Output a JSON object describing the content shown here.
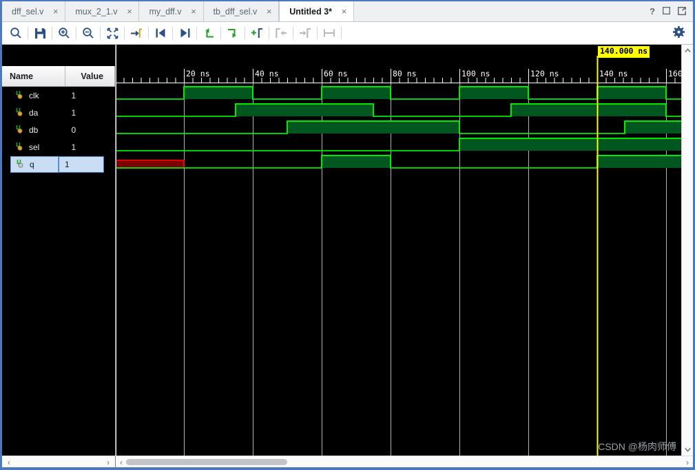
{
  "window": {
    "tabs": [
      {
        "label": "dff_sel.v",
        "active": false,
        "close": "×"
      },
      {
        "label": "mux_2_1.v",
        "active": false,
        "close": "×"
      },
      {
        "label": "my_dff.v",
        "active": false,
        "close": "×"
      },
      {
        "label": "tb_dff_sel.v",
        "active": false,
        "close": "×"
      },
      {
        "label": "Untitled 3*",
        "active": true,
        "close": "×"
      }
    ],
    "buttons": [
      {
        "name": "help-icon",
        "glyph": "?"
      },
      {
        "name": "maximize-icon",
        "glyph": "❑"
      },
      {
        "name": "float-window-icon",
        "glyph": "➦"
      }
    ]
  },
  "toolbar": {
    "items": [
      {
        "name": "search-icon",
        "label": "Search",
        "enabled": true
      },
      {
        "sep": true
      },
      {
        "name": "save-icon",
        "label": "Save Waveform Configuration",
        "enabled": true
      },
      {
        "sep": true
      },
      {
        "name": "zoom-in-icon",
        "label": "Zoom In",
        "enabled": true
      },
      {
        "sep": true
      },
      {
        "name": "zoom-out-icon",
        "label": "Zoom Out",
        "enabled": true
      },
      {
        "sep": true
      },
      {
        "name": "zoom-fit-icon",
        "label": "Zoom Fit",
        "enabled": true
      },
      {
        "sep": true
      },
      {
        "name": "goto-cursor-icon",
        "label": "Go To Time 0",
        "enabled": true
      },
      {
        "sep": true
      },
      {
        "name": "previous-transition-icon",
        "label": "Previous Transition",
        "enabled": true
      },
      {
        "sep": true
      },
      {
        "name": "next-transition-icon",
        "label": "Next Transition",
        "enabled": true
      },
      {
        "sep": true
      },
      {
        "name": "previous-marker-icon",
        "label": "Previous Marker",
        "enabled": true
      },
      {
        "sep": true
      },
      {
        "name": "next-marker-icon",
        "label": "Next Marker",
        "enabled": true
      },
      {
        "sep": true
      },
      {
        "name": "add-marker-icon",
        "label": "Add Marker",
        "enabled": true
      },
      {
        "sep": true
      },
      {
        "name": "marker-left-icon",
        "label": "Move Marker Left",
        "enabled": false
      },
      {
        "sep": true
      },
      {
        "name": "marker-right-icon",
        "label": "Move Marker Right",
        "enabled": false
      },
      {
        "sep": true
      },
      {
        "name": "measure-icon",
        "label": "Measure Time",
        "enabled": false
      },
      {
        "sep": true
      }
    ],
    "settings": {
      "name": "gear-icon",
      "label": "Settings"
    }
  },
  "panel": {
    "columns": [
      "Name",
      "Value"
    ],
    "signals": [
      {
        "name": "clk",
        "value": "1",
        "selected": false,
        "icon": "waveform-signal-icon"
      },
      {
        "name": "da",
        "value": "1",
        "selected": false,
        "icon": "waveform-signal-icon"
      },
      {
        "name": "db",
        "value": "0",
        "selected": false,
        "icon": "waveform-signal-icon"
      },
      {
        "name": "sel",
        "value": "1",
        "selected": false,
        "icon": "waveform-signal-icon"
      },
      {
        "name": "q",
        "value": "1",
        "selected": true,
        "icon": "waveform-signal-output-icon"
      }
    ]
  },
  "waveform": {
    "cursor": {
      "label": "140.000 ns",
      "time_ns": 140,
      "color": "#ffff00"
    },
    "time_axis": {
      "major_ticks": [
        {
          "label": "20 ns",
          "time_ns": 20
        },
        {
          "label": "40 ns",
          "time_ns": 40
        },
        {
          "label": "60 ns",
          "time_ns": 60
        },
        {
          "label": "80 ns",
          "time_ns": 80
        },
        {
          "label": "100 ns",
          "time_ns": 100
        },
        {
          "label": "120 ns",
          "time_ns": 120
        },
        {
          "label": "140 ns",
          "time_ns": 140
        },
        {
          "label": "160 ns",
          "time_ns": 160
        }
      ],
      "minor_tick_interval_ns": 2.5,
      "pixels_per_ns": 5,
      "visible_start_ns": 0.4,
      "visible_end_ns": 164
    },
    "colors": {
      "high_fill": "#00561f",
      "edge": "#00ee00",
      "undefined_fill": "#7c0000",
      "undefined_edge": "#ee0000",
      "gridline": "#b4b4b4",
      "background": "#000000"
    },
    "traces": [
      {
        "signal": "clk",
        "transitions": [
          {
            "time_ns": 0,
            "state": "0"
          },
          {
            "time_ns": 20,
            "state": "1"
          },
          {
            "time_ns": 40,
            "state": "0"
          },
          {
            "time_ns": 60,
            "state": "1"
          },
          {
            "time_ns": 80,
            "state": "0"
          },
          {
            "time_ns": 100,
            "state": "1"
          },
          {
            "time_ns": 120,
            "state": "0"
          },
          {
            "time_ns": 140,
            "state": "1"
          },
          {
            "time_ns": 160,
            "state": "0"
          }
        ]
      },
      {
        "signal": "da",
        "transitions": [
          {
            "time_ns": 0,
            "state": "0"
          },
          {
            "time_ns": 35,
            "state": "1"
          },
          {
            "time_ns": 75,
            "state": "0"
          },
          {
            "time_ns": 115,
            "state": "1"
          },
          {
            "time_ns": 160,
            "state": "0"
          }
        ]
      },
      {
        "signal": "db",
        "transitions": [
          {
            "time_ns": 0,
            "state": "0"
          },
          {
            "time_ns": 50,
            "state": "1"
          },
          {
            "time_ns": 100,
            "state": "0"
          },
          {
            "time_ns": 148,
            "state": "1"
          }
        ]
      },
      {
        "signal": "sel",
        "transitions": [
          {
            "time_ns": 0,
            "state": "0"
          },
          {
            "time_ns": 100,
            "state": "1"
          }
        ]
      },
      {
        "signal": "q",
        "transitions": [
          {
            "time_ns": 0,
            "state": "X"
          },
          {
            "time_ns": 20,
            "state": "0"
          },
          {
            "time_ns": 60,
            "state": "1"
          },
          {
            "time_ns": 80,
            "state": "0"
          },
          {
            "time_ns": 140,
            "state": "1"
          }
        ]
      }
    ],
    "gridlines_ns": [
      20,
      40,
      60,
      80,
      100,
      120,
      140,
      160
    ]
  },
  "scrollbars": {
    "panel_left_arrow": "‹",
    "panel_right_arrow": "›",
    "wave_left_arrow": "‹",
    "wave_right_arrow": "›",
    "vertical_up_arrow": "ⱏ",
    "vertical_down_arrow": "ⱟ",
    "horizontal_thumb_percent": 30
  },
  "watermark": "CSDN @杨肉师傅"
}
